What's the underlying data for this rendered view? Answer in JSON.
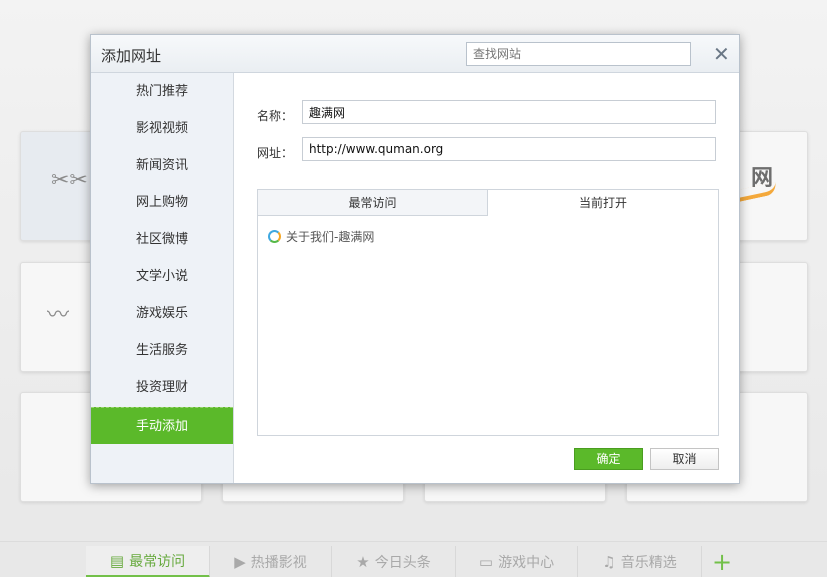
{
  "dialog": {
    "title": "添加网址",
    "search_placeholder": "查找网站",
    "close_symbol": "✕",
    "name_label": "名称：",
    "name_value": "趣满网",
    "url_label": "网址：",
    "url_value": "http://www.quman.org",
    "tabs": [
      {
        "label": "最常访问"
      },
      {
        "label": "当前打开"
      }
    ],
    "history_items": [
      {
        "label": "关于我们-趣满网"
      }
    ],
    "ok_label": "确定",
    "cancel_label": "取消"
  },
  "sidebar": {
    "items": [
      {
        "label": "热门推荐"
      },
      {
        "label": "影视视频"
      },
      {
        "label": "新闻资讯"
      },
      {
        "label": "网上购物"
      },
      {
        "label": "社区微博"
      },
      {
        "label": "文学小说"
      },
      {
        "label": "游戏娱乐"
      },
      {
        "label": "生活服务"
      },
      {
        "label": "投资理财"
      },
      {
        "label": "手动添加",
        "active": true
      }
    ]
  },
  "background": {
    "tile_brand_text": "网"
  },
  "bottom_bar": {
    "tabs": [
      {
        "label": "最常访问",
        "icon": "document-icon",
        "active": true
      },
      {
        "label": "热播影视",
        "icon": "play-icon"
      },
      {
        "label": "今日头条",
        "icon": "star-icon"
      },
      {
        "label": "游戏中心",
        "icon": "gamepad-icon"
      },
      {
        "label": "音乐精选",
        "icon": "music-note-icon"
      }
    ],
    "add_symbol": "+"
  },
  "colors": {
    "accent_green": "#5bb92a",
    "sidebar_bg": "#eef2f7"
  }
}
